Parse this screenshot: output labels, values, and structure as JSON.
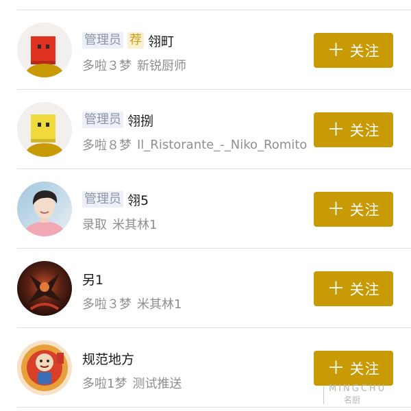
{
  "colors": {
    "accent": "#c89a05",
    "admin_tag_bg": "#eef0f8",
    "admin_tag_text": "#8a93a8",
    "recommend_tag_bg": "#fbf0d2",
    "recommend_tag_text": "#cc9c1a",
    "meta_text": "#8e8e8e",
    "divider": "#dedede"
  },
  "users": [
    {
      "admin_tag": "管理员",
      "recommend_tag": "荐",
      "name": "翎町",
      "rank": "多啦３梦",
      "desc": "新锐厨师",
      "avatar_icon": "red-square-mascot-icon",
      "follow_label": "关注"
    },
    {
      "admin_tag": "管理员",
      "recommend_tag": "",
      "name": "翎捌",
      "rank": "多啦８梦",
      "desc": "Il_Ristorante_-_Niko_Romito",
      "avatar_icon": "yellow-square-mascot-icon",
      "follow_label": "关注"
    },
    {
      "admin_tag": "管理员",
      "recommend_tag": "",
      "name": "翎5",
      "rank": "录取",
      "desc": "米其林1",
      "avatar_icon": "person-photo-avatar",
      "follow_label": "关注"
    },
    {
      "admin_tag": "",
      "recommend_tag": "",
      "name": "另1",
      "rank": "多啦３梦",
      "desc": "米其林1",
      "avatar_icon": "dark-fantasy-art-avatar",
      "follow_label": "关注"
    },
    {
      "admin_tag": "",
      "recommend_tag": "",
      "name": "规范地方",
      "rank": "多啦1梦",
      "desc": "测试推送",
      "avatar_icon": "cartoon-character-avatar",
      "follow_label": "关注"
    }
  ],
  "follow_plus_icon": "plus-icon",
  "watermark": {
    "en": "MINGCHU",
    "cn": "名厨"
  }
}
